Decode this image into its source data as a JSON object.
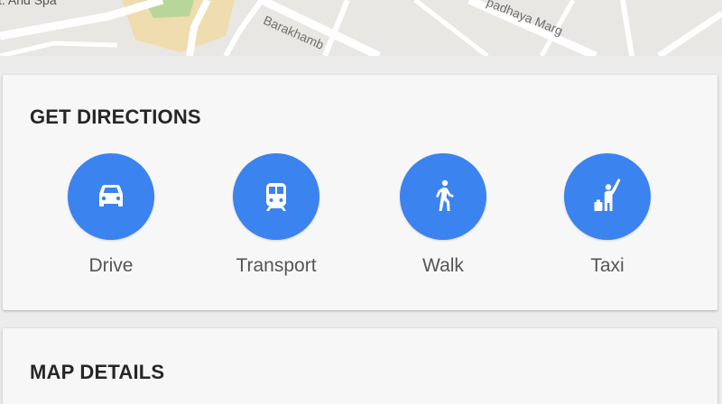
{
  "map": {
    "place_label": "t. And Spa",
    "road_label_1": "Barakhamb",
    "road_label_2": "padhaya Marg",
    "colors": {
      "background": "#e9e7e3",
      "park": "#b9d69a",
      "landmark": "#f2d39a",
      "road": "#ffffff"
    }
  },
  "directions": {
    "title": "GET DIRECTIONS",
    "options": [
      {
        "label": "Drive",
        "icon": "car-icon"
      },
      {
        "label": "Transport",
        "icon": "train-icon"
      },
      {
        "label": "Walk",
        "icon": "walking-person-icon"
      },
      {
        "label": "Taxi",
        "icon": "hail-taxi-icon"
      }
    ],
    "accent_color": "#3b83ef"
  },
  "details": {
    "title": "MAP DETAILS"
  }
}
